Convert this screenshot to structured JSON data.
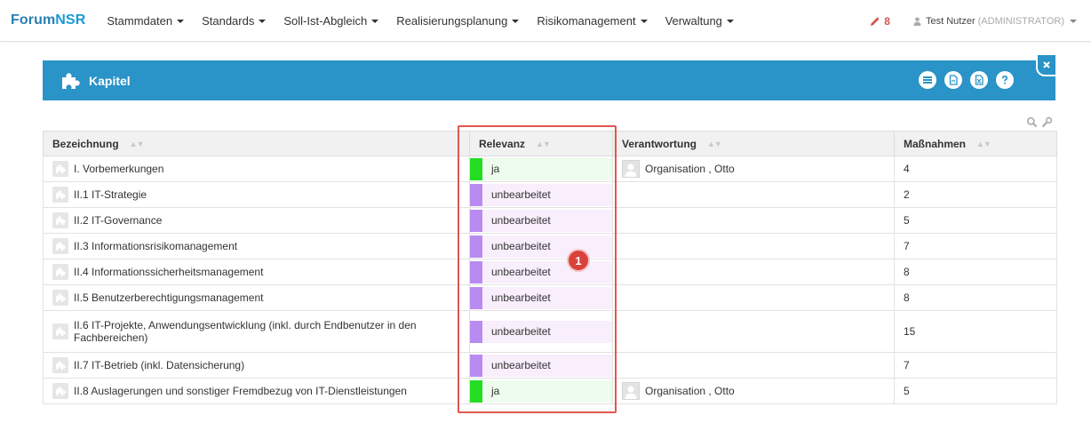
{
  "brand": {
    "part1": "Forum",
    "part2": "NSR"
  },
  "nav": {
    "items": [
      {
        "label": "Stammdaten"
      },
      {
        "label": "Standards"
      },
      {
        "label": "Soll-Ist-Abgleich"
      },
      {
        "label": "Realisierungsplanung"
      },
      {
        "label": "Risikomanagement"
      },
      {
        "label": "Verwaltung"
      }
    ],
    "edit_count": "8",
    "user_name": "Test Nutzer",
    "user_role": "(ADMINISTRATOR)"
  },
  "panel": {
    "title": "Kapitel"
  },
  "table": {
    "headers": {
      "name": "Bezeichnung",
      "relevance": "Relevanz",
      "responsibility": "Verantwortung",
      "measures": "Maßnahmen"
    },
    "rows": [
      {
        "name": "I. Vorbemerkungen",
        "relevance": "ja",
        "responsibility": "Organisation , Otto",
        "measures": "4"
      },
      {
        "name": "II.1 IT-Strategie",
        "relevance": "unbearbeitet",
        "responsibility": "",
        "measures": "2"
      },
      {
        "name": "II.2 IT-Governance",
        "relevance": "unbearbeitet",
        "responsibility": "",
        "measures": "5"
      },
      {
        "name": "II.3 Informationsrisikomanagement",
        "relevance": "unbearbeitet",
        "responsibility": "",
        "measures": "7"
      },
      {
        "name": "II.4 Informationssicherheitsmanagement",
        "relevance": "unbearbeitet",
        "responsibility": "",
        "measures": "8"
      },
      {
        "name": "II.5 Benutzerberechtigungsmanagement",
        "relevance": "unbearbeitet",
        "responsibility": "",
        "measures": "8"
      },
      {
        "name": "II.6 IT-Projekte, Anwendungsentwicklung (inkl. durch Endbenutzer in den Fachbereichen)",
        "relevance": "unbearbeitet",
        "responsibility": "",
        "measures": "15"
      },
      {
        "name": "II.7 IT-Betrieb (inkl. Datensicherung)",
        "relevance": "unbearbeitet",
        "responsibility": "",
        "measures": "7"
      },
      {
        "name": "II.8 Auslagerungen und sonstiger Fremdbezug von IT-Dienstleistungen",
        "relevance": "ja",
        "responsibility": "Organisation , Otto",
        "measures": "5"
      }
    ]
  },
  "callout": {
    "number": "1"
  },
  "colors": {
    "header_blue": "#2a93c8",
    "yes_bar": "#22dd22",
    "yes_bg": "#eefcee",
    "unprocessed_bar": "#b98bf0",
    "unprocessed_bg": "#f8eefc",
    "highlight": "#e05650"
  }
}
